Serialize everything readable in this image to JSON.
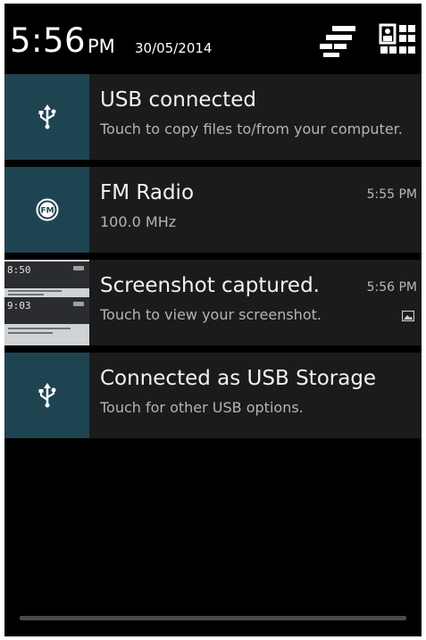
{
  "header": {
    "time": "5:56",
    "ampm": "PM",
    "date": "30/05/2014",
    "settings_icon": "settings-sliders-icon",
    "quick_settings_icon": "quick-settings-icon"
  },
  "notifications": [
    {
      "title": "USB connected",
      "subtitle": "Touch to copy files to/from your computer.",
      "icon": "usb-icon"
    },
    {
      "title": "FM Radio",
      "subtitle": "100.0 MHz",
      "time": "5:55 PM",
      "icon": "fm-radio-icon"
    },
    {
      "title": "Screenshot captured.",
      "subtitle": "Touch to view your screenshot.",
      "time": "5:56 PM",
      "icon": "screenshot-thumbnail",
      "thumbnail_clock_1": "8:50",
      "thumbnail_clock_2": "9:03",
      "badge_icon": "image-icon"
    },
    {
      "title": "Connected as USB Storage",
      "subtitle": "Touch for other USB options.",
      "icon": "usb-icon"
    }
  ],
  "colors": {
    "background": "#000000",
    "notification_bg": "#1b1b1b",
    "icon_box": "#1f4451",
    "title": "#f2f2f2",
    "subtitle": "#b4b4b4"
  }
}
